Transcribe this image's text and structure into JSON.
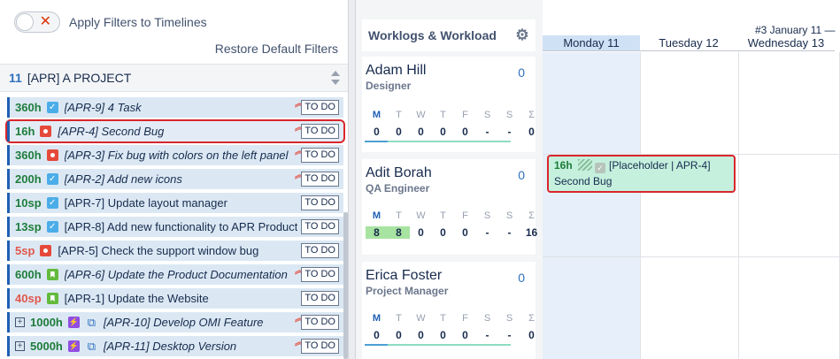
{
  "filters": {
    "toggle_label": "Apply Filters to Timelines",
    "restore_label": "Restore Default Filters"
  },
  "project": {
    "count": "11",
    "name": "[APR] A PROJECT"
  },
  "tasks": [
    {
      "estimate": "360h",
      "type": "task",
      "key_title": "[APR-9] 4 Task",
      "italic": true,
      "status": "TO DO"
    },
    {
      "estimate": "16h",
      "type": "bug",
      "key_title": "[APR-4] Second Bug",
      "italic": true,
      "status": "TO DO"
    },
    {
      "estimate": "360h",
      "type": "bug",
      "key_title": "[APR-3] Fix bug with colors on the left panel",
      "italic": true,
      "status": "TO DO"
    },
    {
      "estimate": "200h",
      "type": "task",
      "key_title": "[APR-2] Add new icons",
      "italic": true,
      "status": "TO DO"
    },
    {
      "estimate": "10sp",
      "type": "task",
      "key_title": "[APR-7] Update layout manager",
      "italic": false,
      "status": "TO DO"
    },
    {
      "estimate": "13sp",
      "type": "task",
      "key_title": "[APR-8] Add new functionality to APR Product",
      "italic": false,
      "status": "TO DO"
    },
    {
      "estimate": "5sp",
      "type": "bug",
      "key_title": "[APR-5] Check the support window bug",
      "italic": false,
      "status": "TO DO"
    },
    {
      "estimate": "600h",
      "type": "story",
      "key_title": "[APR-6] Update the Product Documentation",
      "italic": true,
      "status": "TO DO"
    },
    {
      "estimate": "40sp",
      "type": "story",
      "key_title": "[APR-1] Update the Website",
      "italic": false,
      "status": "TO DO"
    },
    {
      "estimate": "1000h",
      "type": "epic",
      "key_title": "[APR-10] Develop OMI Feature",
      "italic": true,
      "status": "TO DO"
    },
    {
      "estimate": "5000h",
      "type": "epic",
      "key_title": "[APR-11] Desktop Version",
      "italic": true,
      "status": "TO DO"
    }
  ],
  "workload": {
    "header": "Worklogs & Workload",
    "days": [
      "M",
      "T",
      "W",
      "T",
      "F",
      "S",
      "S",
      "Σ"
    ],
    "people": [
      {
        "name": "Adam Hill",
        "role": "Designer",
        "count": "0",
        "values": [
          "0",
          "0",
          "0",
          "0",
          "0",
          "-",
          "-",
          "0"
        ]
      },
      {
        "name": "Adit Borah",
        "role": "QA Engineer",
        "count": "0",
        "values": [
          "8",
          "8",
          "0",
          "0",
          "0",
          "-",
          "-",
          "16"
        ]
      },
      {
        "name": "Erica Foster",
        "role": "Project Manager",
        "count": "0",
        "values": [
          "0",
          "0",
          "0",
          "0",
          "0",
          "-",
          "-",
          "0"
        ]
      }
    ]
  },
  "calendar": {
    "week_title": "#3 January 11 —",
    "columns": [
      "Monday 11",
      "Tuesday 12",
      "Wednesday 13"
    ]
  },
  "card": {
    "hours": "16h",
    "title_line1": "[Placeholder | APR-4]",
    "title_line2": "Second Bug"
  }
}
